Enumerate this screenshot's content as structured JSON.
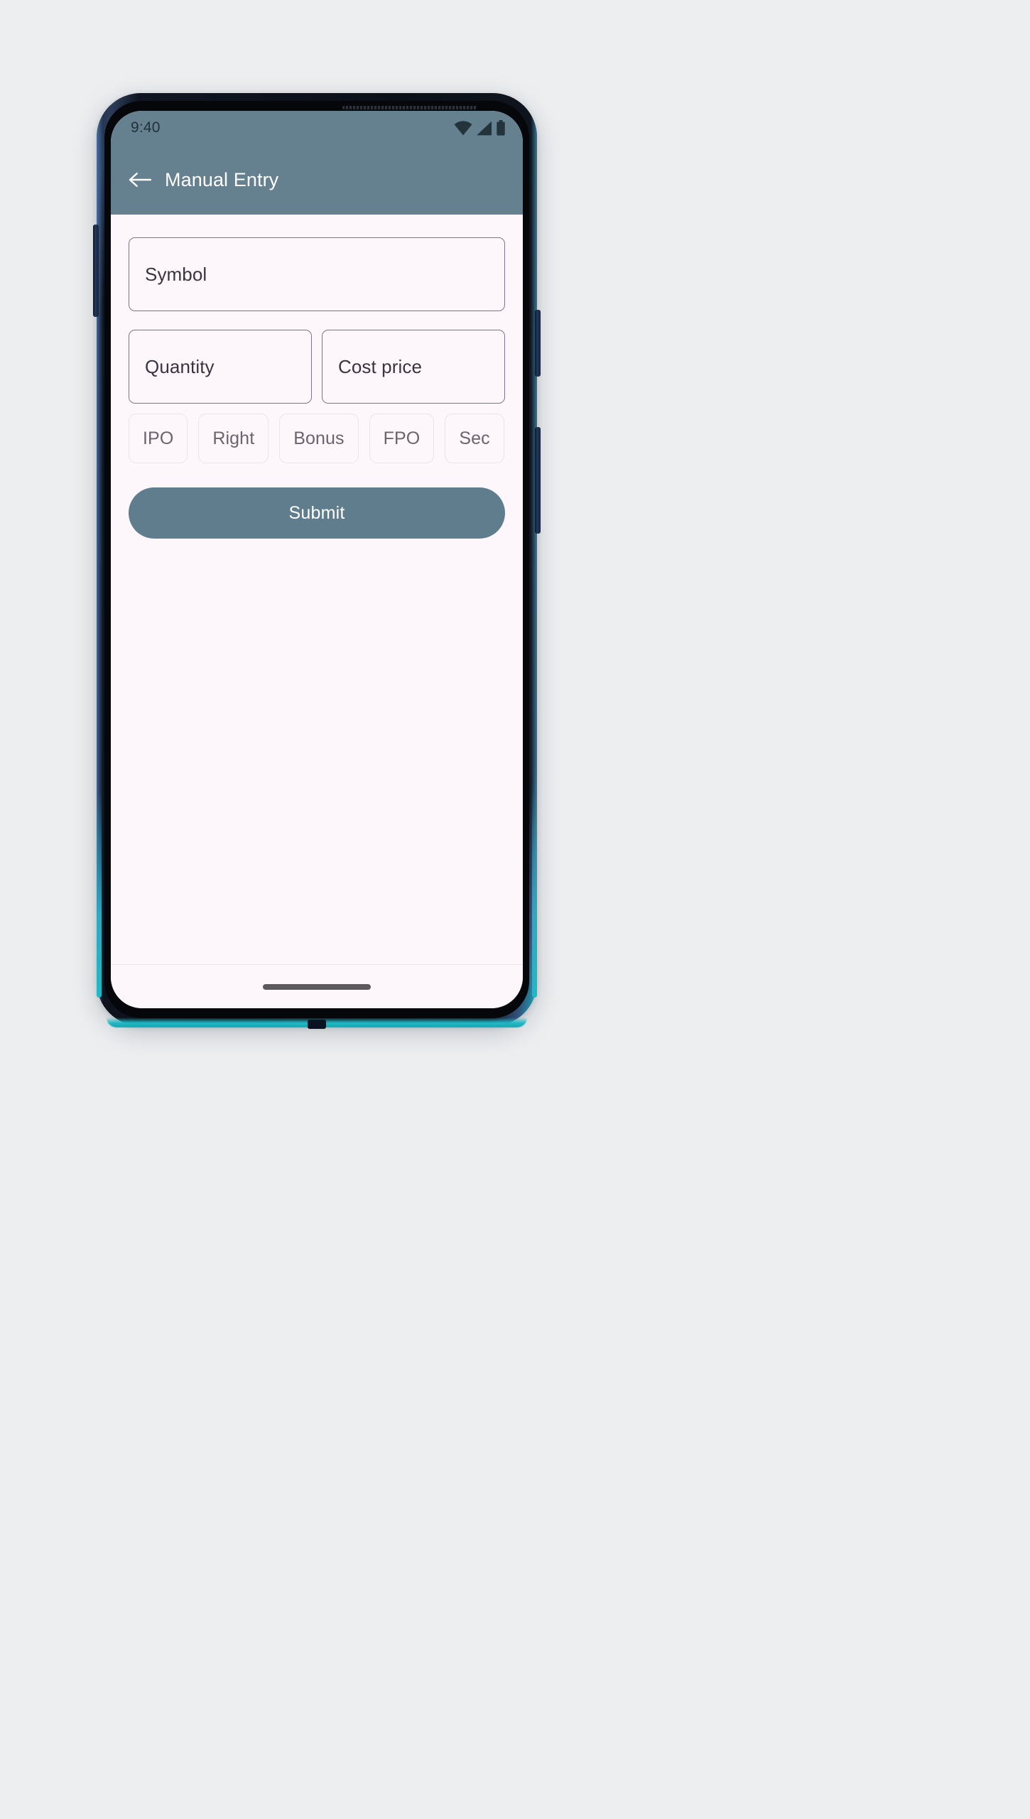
{
  "statusbar": {
    "time": "9:40",
    "icons": [
      "wifi-icon",
      "cellular-signal-icon",
      "battery-icon"
    ]
  },
  "appbar": {
    "back_icon": "back-arrow-icon",
    "title": "Manual Entry",
    "background_color": "#65808f",
    "title_color": "#ffffff"
  },
  "form": {
    "symbol": {
      "placeholder": "Symbol",
      "value": ""
    },
    "quantity": {
      "placeholder": "Quantity",
      "value": ""
    },
    "cost_price": {
      "placeholder": "Cost price",
      "value": ""
    },
    "chips": [
      {
        "label": "IPO",
        "selected": false
      },
      {
        "label": "Right",
        "selected": false
      },
      {
        "label": "Bonus",
        "selected": false
      },
      {
        "label": "FPO",
        "selected": false
      },
      {
        "label": "Sec",
        "selected": false
      }
    ],
    "submit": {
      "label": "Submit",
      "color": "#5f7d8c",
      "text_color": "#ffffff"
    }
  },
  "navbar": {
    "home_indicator": "home-indicator"
  },
  "theme": {
    "page_background": "#fdf7fb",
    "scene_background": "#eceef0",
    "accent": "#5f7d8c",
    "field_border": "#7c7682",
    "chip_border": "#e9e3ec",
    "device_edge_accent": "#1fb9c6"
  }
}
